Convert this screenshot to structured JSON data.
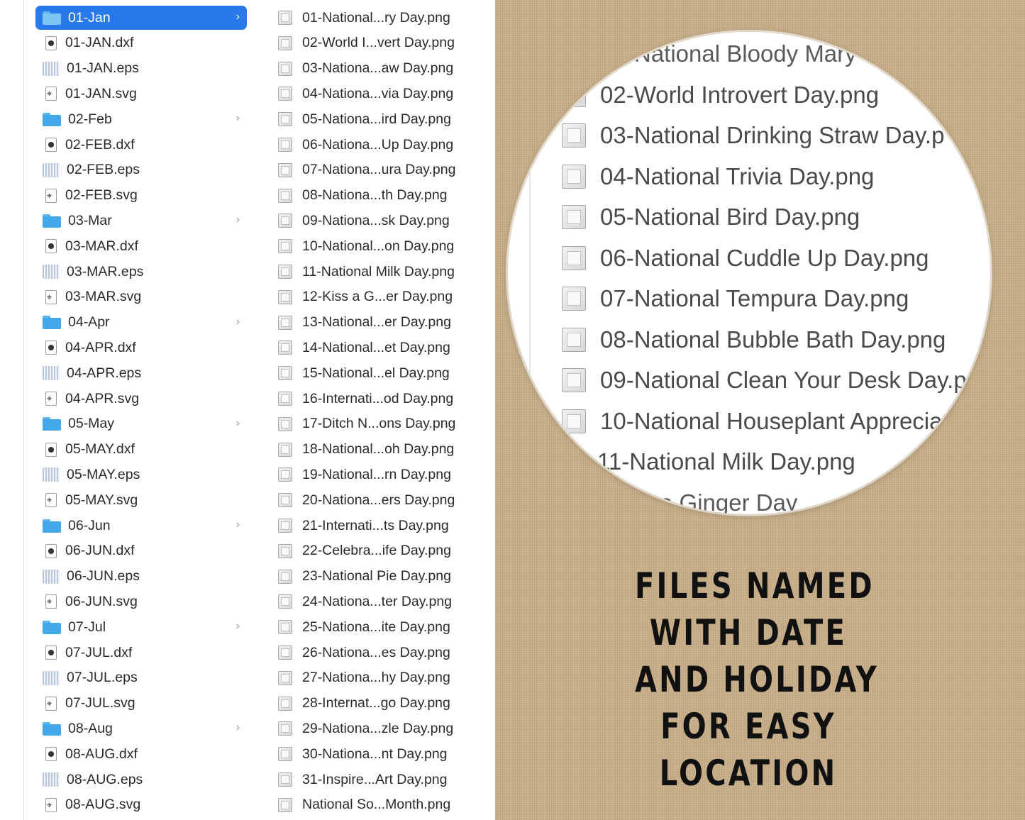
{
  "finder": {
    "column1": [
      {
        "label": "01-Jan",
        "kind": "folder",
        "selected": true
      },
      {
        "label": "01-JAN.dxf",
        "kind": "dxf"
      },
      {
        "label": "01-JAN.eps",
        "kind": "eps"
      },
      {
        "label": "01-JAN.svg",
        "kind": "svg"
      },
      {
        "label": "02-Feb",
        "kind": "folder"
      },
      {
        "label": "02-FEB.dxf",
        "kind": "dxf"
      },
      {
        "label": "02-FEB.eps",
        "kind": "eps"
      },
      {
        "label": "02-FEB.svg",
        "kind": "svg"
      },
      {
        "label": "03-Mar",
        "kind": "folder"
      },
      {
        "label": "03-MAR.dxf",
        "kind": "dxf"
      },
      {
        "label": "03-MAR.eps",
        "kind": "eps"
      },
      {
        "label": "03-MAR.svg",
        "kind": "svg"
      },
      {
        "label": "04-Apr",
        "kind": "folder"
      },
      {
        "label": "04-APR.dxf",
        "kind": "dxf"
      },
      {
        "label": "04-APR.eps",
        "kind": "eps"
      },
      {
        "label": "04-APR.svg",
        "kind": "svg"
      },
      {
        "label": "05-May",
        "kind": "folder"
      },
      {
        "label": "05-MAY.dxf",
        "kind": "dxf"
      },
      {
        "label": "05-MAY.eps",
        "kind": "eps"
      },
      {
        "label": "05-MAY.svg",
        "kind": "svg"
      },
      {
        "label": "06-Jun",
        "kind": "folder"
      },
      {
        "label": "06-JUN.dxf",
        "kind": "dxf"
      },
      {
        "label": "06-JUN.eps",
        "kind": "eps"
      },
      {
        "label": "06-JUN.svg",
        "kind": "svg"
      },
      {
        "label": "07-Jul",
        "kind": "folder"
      },
      {
        "label": "07-JUL.dxf",
        "kind": "dxf"
      },
      {
        "label": "07-JUL.eps",
        "kind": "eps"
      },
      {
        "label": "07-JUL.svg",
        "kind": "svg"
      },
      {
        "label": "08-Aug",
        "kind": "folder"
      },
      {
        "label": "08-AUG.dxf",
        "kind": "dxf"
      },
      {
        "label": "08-AUG.eps",
        "kind": "eps"
      },
      {
        "label": "08-AUG.svg",
        "kind": "svg"
      }
    ],
    "column2": [
      "01-National...ry Day.png",
      "02-World I...vert Day.png",
      "03-Nationa...aw Day.png",
      "04-Nationa...via Day.png",
      "05-Nationa...ird Day.png",
      "06-Nationa...Up Day.png",
      "07-Nationa...ura Day.png",
      "08-Nationa...th Day.png",
      "09-Nationa...sk Day.png",
      "10-National...on Day.png",
      "11-National Milk Day.png",
      "12-Kiss a G...er Day.png",
      "13-National...er Day.png",
      "14-National...et Day.png",
      "15-National...el Day.png",
      "16-Internati...od Day.png",
      "17-Ditch N...ons Day.png",
      "18-National...oh Day.png",
      "19-National...rn Day.png",
      "20-Nationa...ers Day.png",
      "21-Internati...ts Day.png",
      "22-Celebra...ife Day.png",
      "23-National Pie Day.png",
      "24-Nationa...ter Day.png",
      "25-Nationa...ite Day.png",
      "26-Nationa...es Day.png",
      "27-Nationa...hy Day.png",
      "28-Internat...go Day.png",
      "29-Nationa...zle Day.png",
      "30-Nationa...nt Day.png",
      "31-Inspire...Art Day.png",
      "National So...Month.png"
    ]
  },
  "zoom": {
    "rows": [
      "National Bloody Mary",
      "02-World Introvert Day.png",
      "03-National Drinking Straw Day.p",
      "04-National Trivia Day.png",
      "05-National Bird Day.png",
      "06-National Cuddle Up Day.png",
      "07-National Tempura Day.png",
      "08-National Bubble Bath Day.png",
      "09-National Clean Your Desk Day.p",
      "10-National Houseplant Apprecia",
      "11-National Milk Day.png",
      "a Ginger Day"
    ]
  },
  "caption": {
    "lines": [
      "FILES NAMED",
      "WITH DATE",
      "AND HOLIDAY",
      "FOR EASY",
      "LOCATION"
    ]
  },
  "icons": {
    "folder": "folder-icon",
    "dxf": "dxf-file-icon",
    "eps": "eps-file-icon",
    "svg": "svg-file-icon",
    "png": "png-file-icon",
    "chevron": "chevron-right-icon"
  },
  "colors": {
    "selection": "#2a79ea",
    "folder": "#43a7ec",
    "background": "#c8ae88"
  }
}
